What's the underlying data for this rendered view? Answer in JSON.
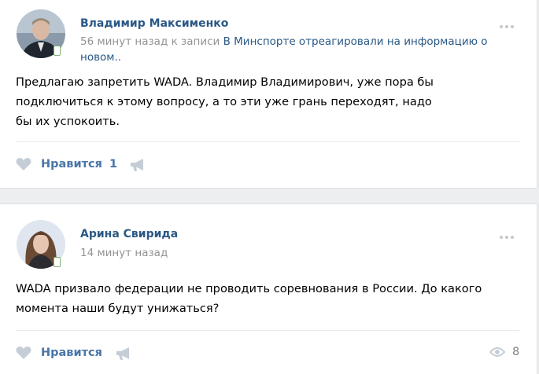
{
  "posts": [
    {
      "author": "Владимир Максименко",
      "time": "56 минут назад",
      "context_prefix": "к записи",
      "context_link": "В Минспорте отреагировали на информацию о новом..",
      "text": "Предлагаю запретить WADA. Владимир Владимирович, уже пора бы подключиться к этому вопросу, а то эти уже грань переходят, надо бы их успокоить.",
      "like_label": "Нравится",
      "like_count": "1",
      "icons": {
        "like": "heart-icon",
        "share": "megaphone-icon",
        "menu": "more-dots-icon",
        "device": "mobile-phone-icon"
      }
    },
    {
      "author": "Арина Свирида",
      "time": "14 минут назад",
      "text": "WADA призвало федерации не проводить соревнования в России. До какого момента наши будут унижаться?",
      "like_label": "Нравится",
      "views": "8",
      "icons": {
        "like": "heart-icon",
        "share": "megaphone-icon",
        "views": "eye-icon",
        "menu": "more-dots-icon",
        "device": "mobile-phone-icon"
      }
    }
  ],
  "colors": {
    "link": "#2a5885",
    "action": "#4a76a8",
    "meta": "#939393",
    "icon": "#c5cdd7",
    "background": "#edeef0"
  }
}
